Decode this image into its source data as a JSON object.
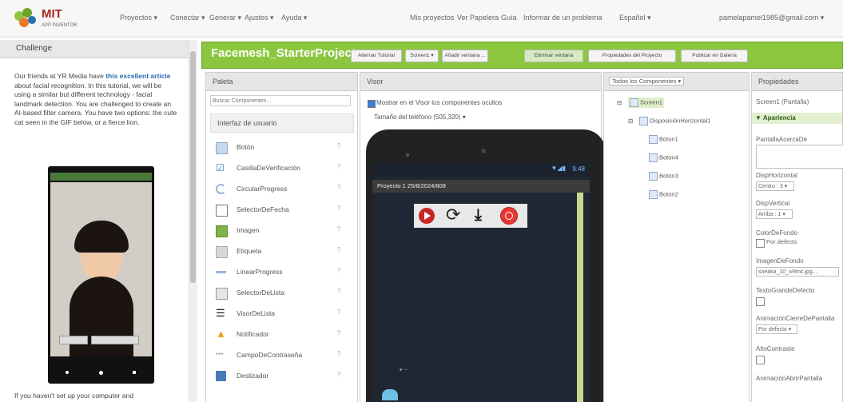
{
  "topnav": {
    "logo_text": "MIT",
    "logo_sub": "APP INVENTOR",
    "menus": [
      "Proyectos ▾",
      "Conectar ▾",
      "Generar ▾",
      "Ajustes ▾",
      "Ayuda ▾"
    ],
    "links": [
      "Mis proyectos",
      "Ver Papelera",
      "Guía",
      "Informar de un problema",
      "Español ▾",
      "pamelapamel1985@gmail.com ▾"
    ]
  },
  "tutorial": {
    "header": "Challenge",
    "text_start": "Our friends at YR Media have ",
    "link": "this excellent article",
    "text_end": " about facial recognition. In this tutorial, we will be using a similar but different technology - facial landmark detection. You are challenged to create an AI-based filter camera. You have two options: the cute cat seen in the GIF below, or a fierce lion.",
    "footer": "If you haven't set up your computer and"
  },
  "toolbar": {
    "project_name": "Facemesh_StarterProject",
    "buttons": [
      "Alternar Tutorial",
      "Screen1 ▾",
      "Añadir ventana ...",
      "Eliminar ventana",
      "Propiedades del Proyecto",
      "Publicar en Galería"
    ]
  },
  "palette": {
    "header": "Paleta",
    "search_placeholder": "Buscar Componentes...",
    "section": "Interfaz de usuario",
    "items": [
      "Botón",
      "CasillaDeVerificación",
      "CircularProgress",
      "SelectorDeFecha",
      "Imagen",
      "Etiqueta",
      "LinearProgress",
      "SelectorDeLista",
      "VisorDeLista",
      "Notificador",
      "CampoDeContraseña",
      "Deslizador"
    ],
    "help": "?"
  },
  "viewer": {
    "header": "Visor",
    "show_hidden": "Mostrar en el Visor los componentes ocultos",
    "size_select": "Tamaño del teléfono (505,320) ▾",
    "status_time": "9:48",
    "app_title": "Proyecto 1 25/8/2024/808"
  },
  "components": {
    "header": "Todos los Componentes ▾",
    "tree": [
      "Screen1",
      "DisposiciónHorizontal1",
      "Boton1",
      "Boton4",
      "Boton3",
      "Boton2"
    ]
  },
  "properties": {
    "header": "Propiedades",
    "subject": "Screen1 (Pantalla)",
    "section": "▼ Apariencia",
    "rows": [
      {
        "label": "PantallaAcercaDe",
        "value": ""
      },
      {
        "label": "DispHorizontal",
        "value": "Centro : 3 ▾"
      },
      {
        "label": "DispVertical",
        "value": "Arriba : 1 ▾"
      },
      {
        "label": "ColorDeFondo",
        "value": "Por defecto"
      },
      {
        "label": "ImagenDeFondo",
        "value": "sneaka_10_w9mc.jpg..."
      },
      {
        "label": "TextoGrandeDefecto",
        "value": ""
      },
      {
        "label": "AnimaciónCierreDePantalla",
        "value": "Por defecto ▾"
      },
      {
        "label": "AltoContraste",
        "value": ""
      },
      {
        "label": "AnimaciónAbrirPantalla",
        "value": ""
      }
    ]
  },
  "colors": {
    "green": "#8cc63f",
    "dark": "#1e2733"
  }
}
